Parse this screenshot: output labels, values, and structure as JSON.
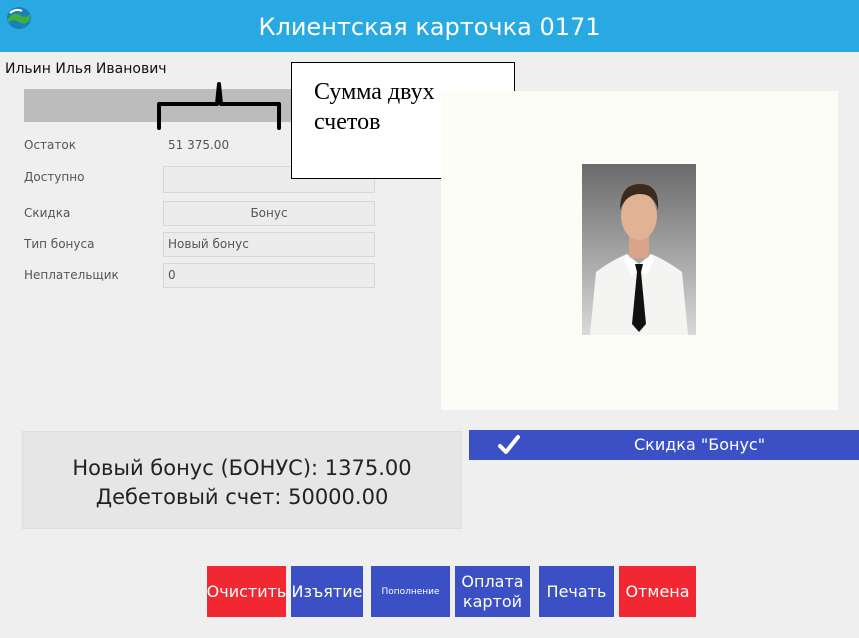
{
  "window": {
    "title": "Клиентская карточка 0171"
  },
  "client": {
    "name": "Ильин Илья Иванович"
  },
  "fields": {
    "balance": {
      "label": "Остаток",
      "value": "51 375.00"
    },
    "available": {
      "label": "Доступно",
      "value": ""
    },
    "discount": {
      "label": "Скидка",
      "value": "Бонус"
    },
    "bonus_type": {
      "label": "Тип бонуса",
      "value": "Новый бонус"
    },
    "non_payer": {
      "label": "Неплательщик",
      "value": "0"
    }
  },
  "callout": {
    "line1": "Сумма двух",
    "line2": "счетов"
  },
  "summary": {
    "bonus_line": "Новый бонус (БОНУС): 1375.00",
    "debit_line": "Дебетовый счет: 50000.00"
  },
  "discount_bar": {
    "label": "Скидка \"Бонус\""
  },
  "buttons": {
    "clear": "Очистить",
    "withdraw": "Изъятие",
    "topup": "Пополнение",
    "pay_line1": "Оплата",
    "pay_line2": "картой",
    "print": "Печать",
    "cancel": "Отмена"
  },
  "colors": {
    "titlebar": "#29a9e1",
    "button_red": "#f12831",
    "button_blue": "#3b50c4",
    "accent_blue": "#3b50c4"
  },
  "icons": [
    "app-logo-icon",
    "check-icon",
    "client-photo"
  ]
}
